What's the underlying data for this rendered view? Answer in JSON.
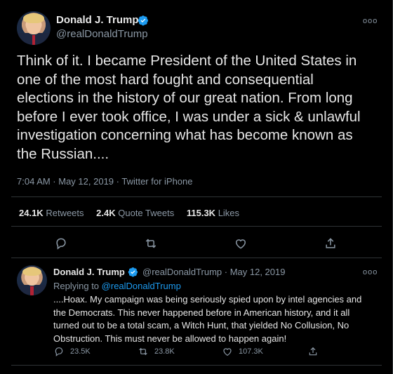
{
  "main_tweet": {
    "author_name": "Donald J. Trump",
    "handle": "@realDonaldTrump",
    "text": "Think of it. I became President of the United States in one of the most hard fought and consequential elections in the history of our great nation. From long before I ever took office, I was under a sick & unlawful investigation concerning what has become known as the Russian....",
    "timestamp": "7:04 AM · May 12, 2019 · Twitter for iPhone",
    "retweets_value": "24.1K",
    "retweets_label": "Retweets",
    "quote_value": "2.4K",
    "quote_label": "Quote Tweets",
    "likes_value": "115.3K",
    "likes_label": "Likes",
    "more_label": "ooo"
  },
  "reply_tweet": {
    "author_name": "Donald J. Trump",
    "handle_date": "@realDonaldTrump · May 12, 2019",
    "replying_prefix": "Replying to",
    "replying_to": "@realDonaldTrump",
    "text": "....Hoax. My campaign was being seriously spied upon by intel agencies and the Democrats. This never happened before in American history, and it all turned out to be a total scam, a Witch Hunt, that yielded No Collusion, No Obstruction. This must never be allowed to happen again!",
    "reply_count": "23.5K",
    "retweet_count": "23.8K",
    "like_count": "107.3K",
    "more_label": "ooo"
  },
  "colors": {
    "background": "#000000",
    "accent": "#1d9bf0",
    "muted": "#8b98a5",
    "divider": "#2f3336"
  },
  "icons": [
    "verified-badge-icon",
    "reply-icon",
    "retweet-icon",
    "like-icon",
    "share-icon",
    "more-icon"
  ]
}
